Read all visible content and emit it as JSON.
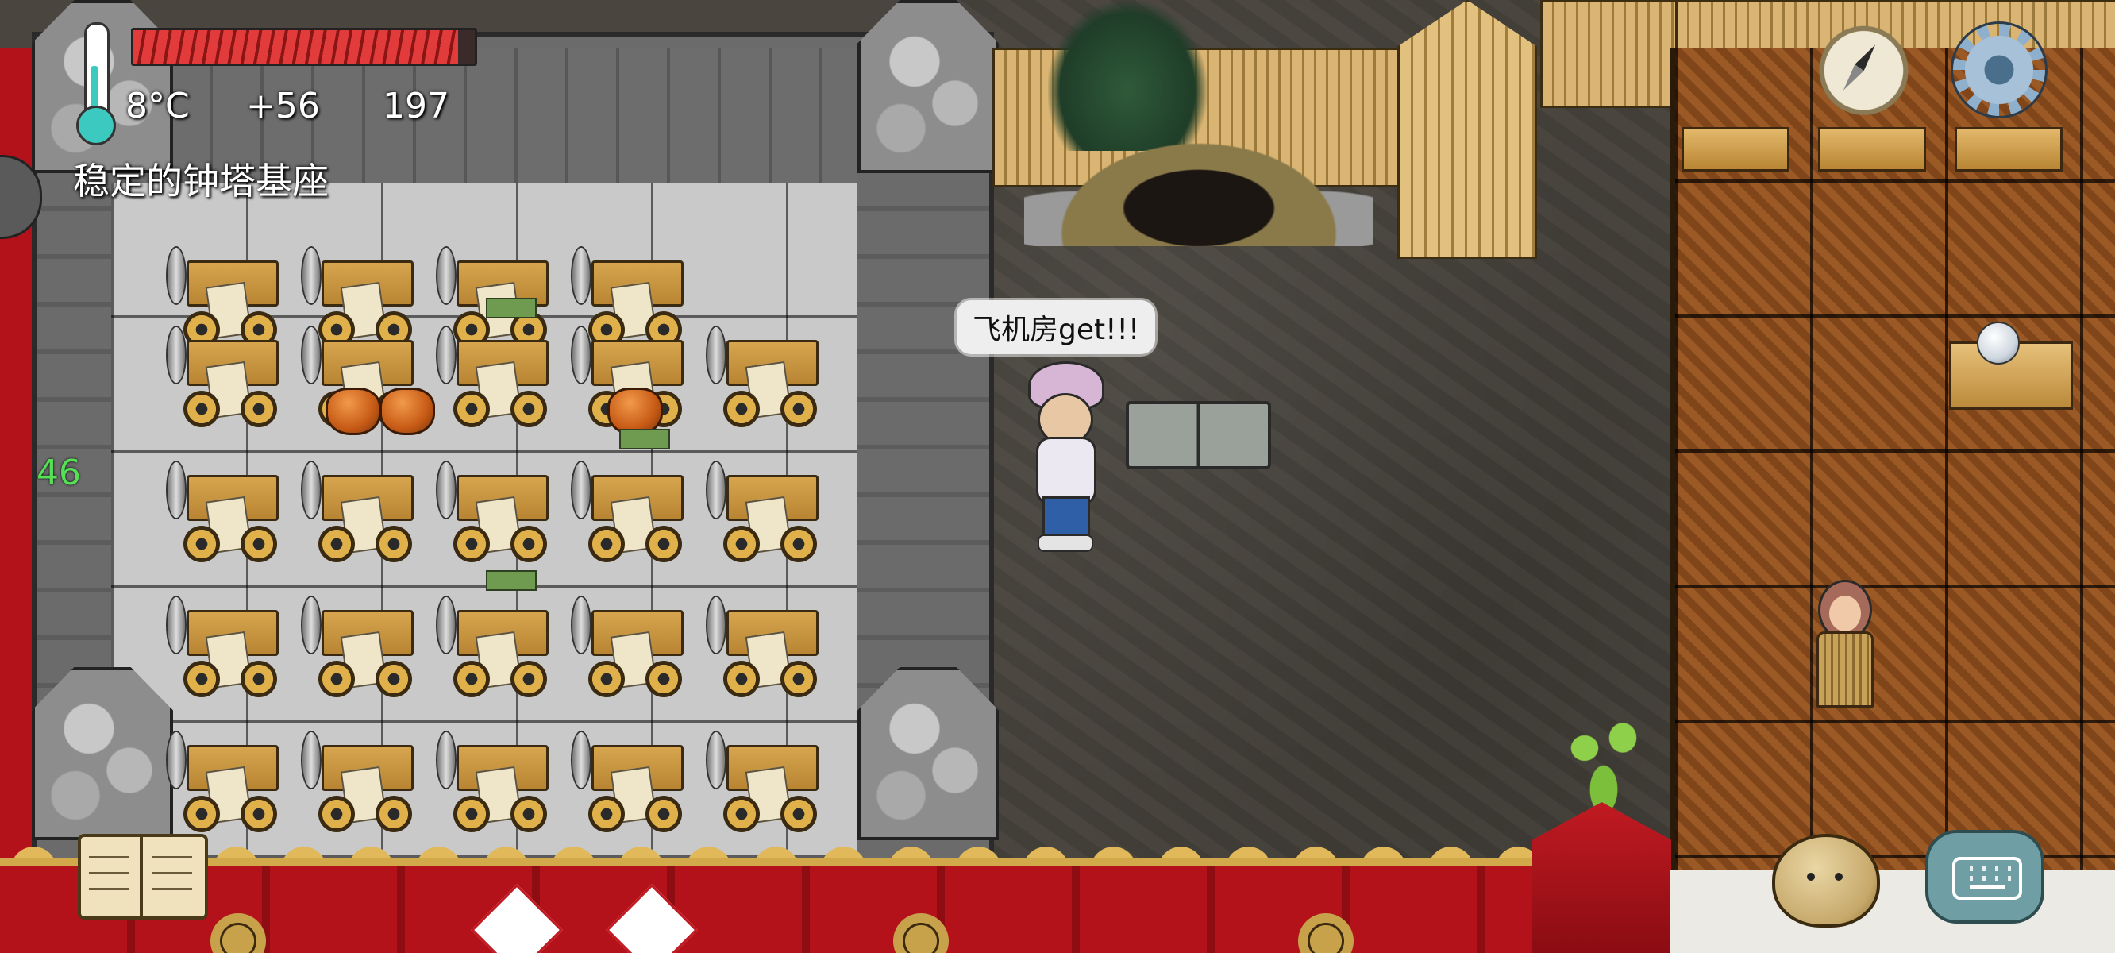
{
  "hud": {
    "temperature": "8°C",
    "yum_bonus": "+56",
    "yum_count": "197",
    "food_meter": {
      "fill_fraction": 0.95
    },
    "thermometer": {
      "icon": "thermometer-icon",
      "level_fraction": 0.55
    },
    "hover_label": "稳定的钟塔基座",
    "side_number": "46"
  },
  "chat": {
    "speech_bubble": "飞机房get!!!"
  },
  "buttons": {
    "compass": "compass-icon",
    "settings": "gear-icon",
    "tech_book": "book-icon",
    "emote": "emote-face-icon",
    "keyboard": "keyboard-icon"
  },
  "colors": {
    "food_bar": "#e23b3b",
    "temperature_fill": "#3cc9c0",
    "side_number": "#55e055",
    "red_wall": "#b4121a",
    "settings_gear": "#8fb0cc",
    "keyboard_button": "#6f9fa4"
  }
}
